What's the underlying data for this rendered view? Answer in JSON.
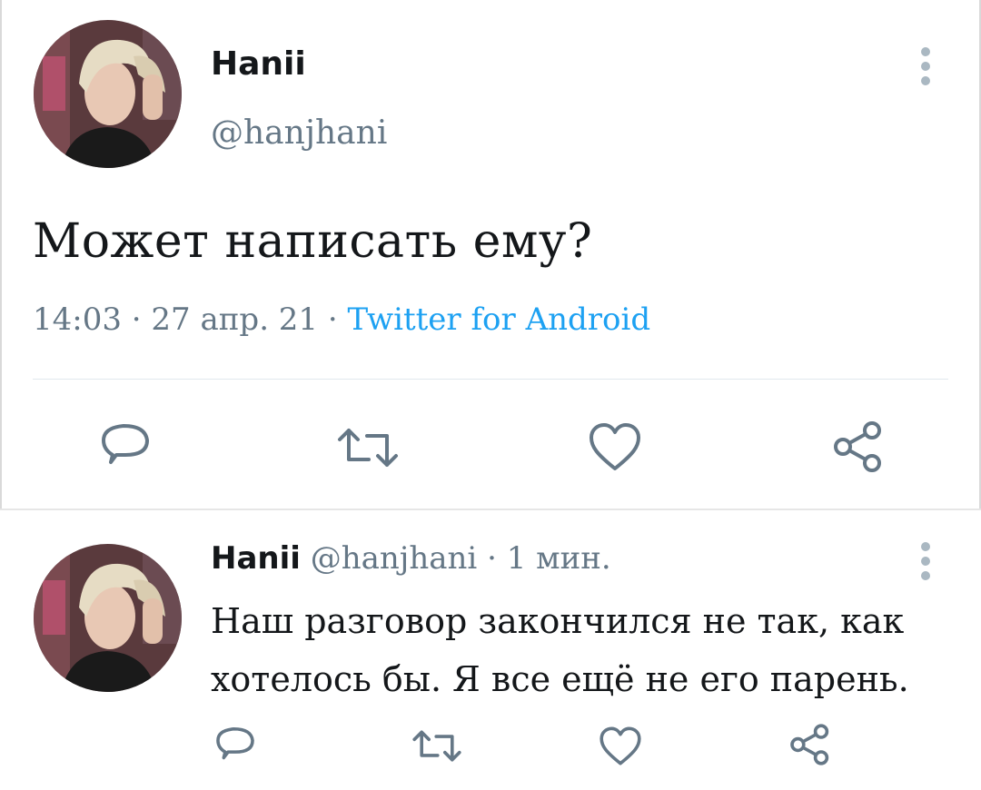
{
  "tweet_main": {
    "display_name": "Hanii",
    "handle": "@hanjhani",
    "text": "Может написать ему?",
    "time": "14:03",
    "date": "27 апр. 21",
    "separator": "·",
    "source": "Twitter for Android",
    "actions": [
      "reply-icon",
      "retweet-icon",
      "like-icon",
      "share-icon"
    ]
  },
  "tweet_reply": {
    "display_name": "Hanii",
    "handle": "@hanjhani",
    "separator": "·",
    "time_ago": "1 мин.",
    "text": "Наш разговор закончился не так, как хотелось бы. Я все ещё не его парень.",
    "actions": [
      "reply-icon",
      "retweet-icon",
      "like-icon",
      "share-icon"
    ]
  },
  "colors": {
    "text": "#14171a",
    "secondary": "#657786",
    "link": "#1da1f2",
    "icon": "#657786"
  }
}
